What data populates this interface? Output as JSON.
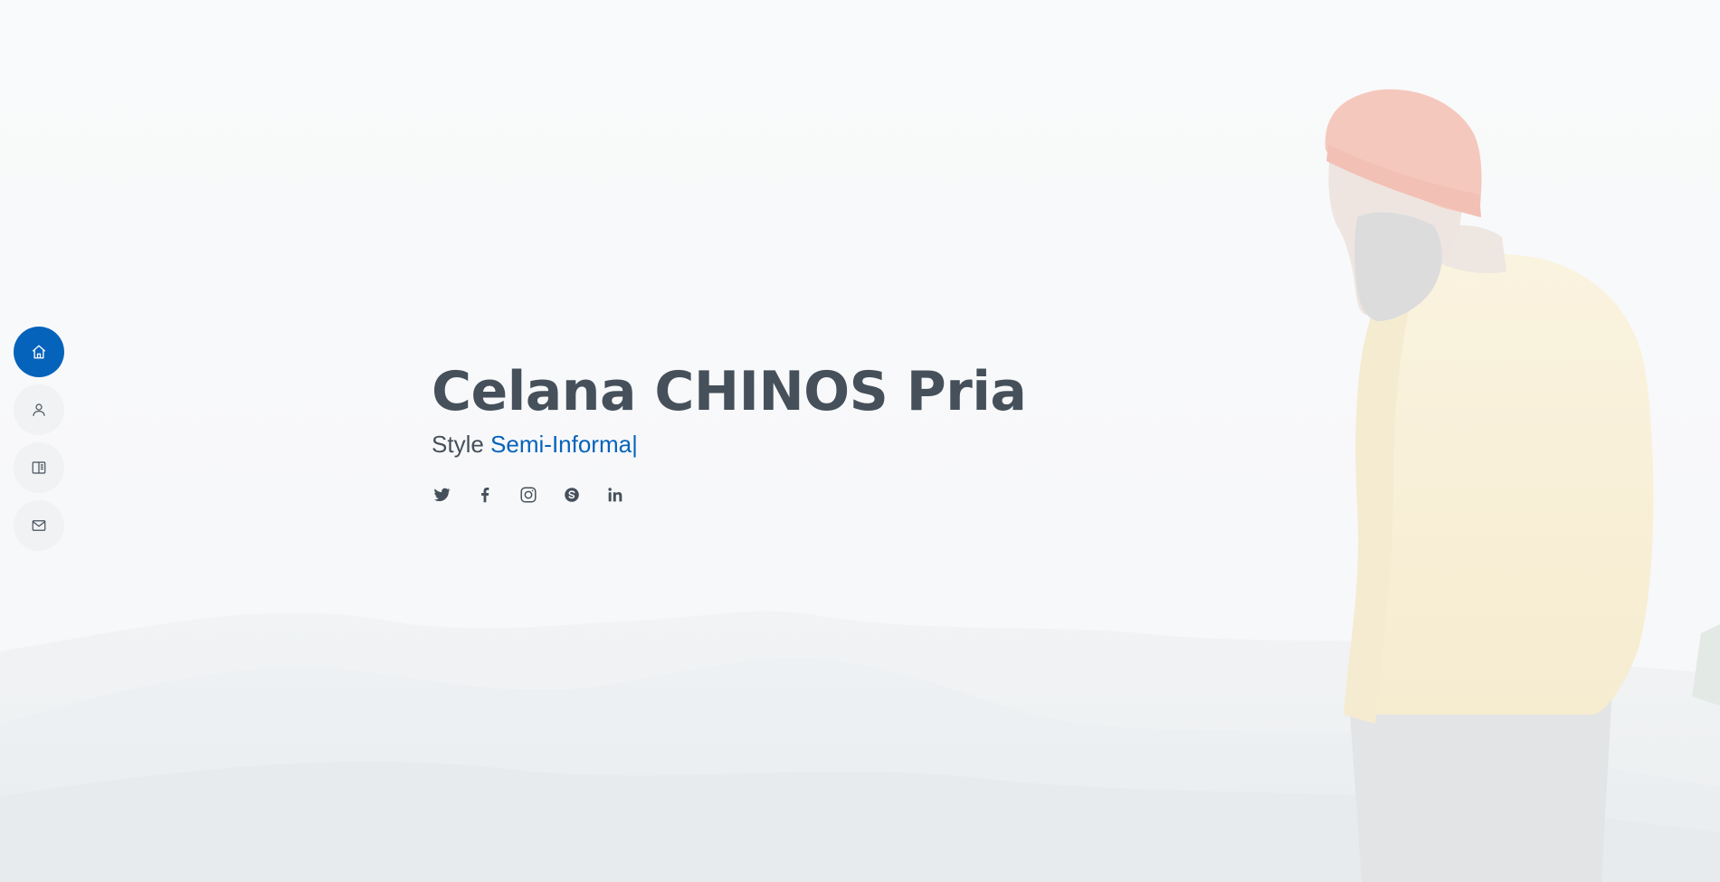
{
  "hero": {
    "name": "Celana CHINOS Pria",
    "tagline_prefix": "Style",
    "tagline_typed": "Semi-Informa",
    "tagline_cursor": "|"
  },
  "nav": {
    "items": [
      {
        "icon": "home-icon",
        "active": true
      },
      {
        "icon": "person-icon",
        "active": false
      },
      {
        "icon": "book-icon",
        "active": false
      },
      {
        "icon": "envelope-icon",
        "active": false
      }
    ]
  },
  "socials": [
    {
      "icon": "twitter-icon"
    },
    {
      "icon": "facebook-icon"
    },
    {
      "icon": "instagram-icon"
    },
    {
      "icon": "skype-icon"
    },
    {
      "icon": "linkedin-icon"
    }
  ],
  "colors": {
    "accent": "#0563bb",
    "text": "#45505b",
    "nav_bg": "#f1f2f3"
  }
}
